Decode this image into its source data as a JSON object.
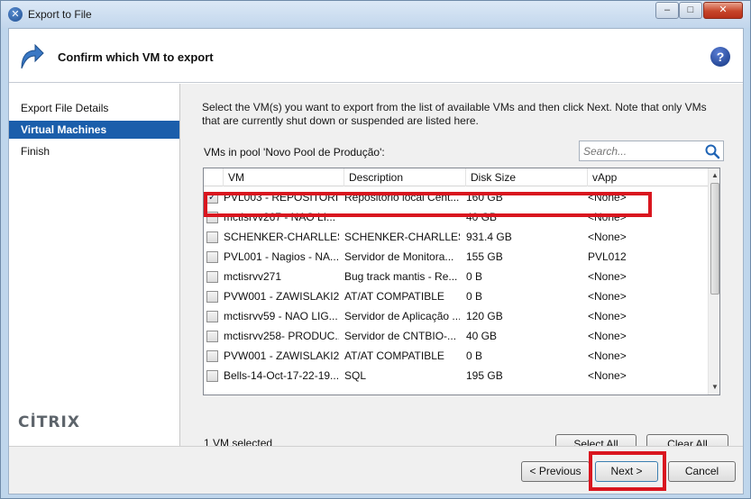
{
  "window": {
    "title": "Export to File",
    "min_label": "–",
    "max_label": "□",
    "close_label": "✕"
  },
  "header": {
    "title": "Confirm which VM to export",
    "help_label": "?"
  },
  "sidebar": {
    "items": [
      {
        "label": "Export File Details",
        "active": false
      },
      {
        "label": "Virtual Machines",
        "active": true
      },
      {
        "label": "Finish",
        "active": false
      }
    ],
    "logo_text": "CİTRIX"
  },
  "content": {
    "instructions": "Select the VM(s) you want to export from the list of available VMs and then click Next. Note that only VMs that are currently shut down or suspended are listed here.",
    "pool_label": "VMs in pool 'Novo Pool de Produção':",
    "search_placeholder": "Search...",
    "columns": [
      "VM",
      "Description",
      "Disk Size",
      "vApp"
    ],
    "rows": [
      {
        "checked": "✓",
        "vm": "PVL003 - REPOSITORI...",
        "description": "Repositorio local Cent...",
        "disk": "160 GB",
        "vapp": "<None>"
      },
      {
        "checked": "",
        "vm": "mctisrvv267 - NAO LI...",
        "description": "",
        "disk": "40 GB",
        "vapp": "<None>"
      },
      {
        "checked": "",
        "vm": "SCHENKER-CHARLLES",
        "description": "SCHENKER-CHARLLES...",
        "disk": "931.4 GB",
        "vapp": "<None>"
      },
      {
        "checked": "",
        "vm": "PVL001 - Nagios - NA...",
        "description": "Servidor de Monitora...",
        "disk": "155 GB",
        "vapp": "PVL012"
      },
      {
        "checked": "",
        "vm": "mctisrvv271",
        "description": "Bug track mantis - Re...",
        "disk": "0 B",
        "vapp": "<None>"
      },
      {
        "checked": "",
        "vm": "PVW001 - ZAWISLAKI2",
        "description": "AT/AT COMPATIBLE",
        "disk": "0 B",
        "vapp": "<None>"
      },
      {
        "checked": "",
        "vm": "mctisrvv59 - NAO LIG...",
        "description": "Servidor de Aplicação ...",
        "disk": "120 GB",
        "vapp": "<None>"
      },
      {
        "checked": "",
        "vm": "mctisrvv258- PRODUC...",
        "description": "Servidor de CNTBIO-...",
        "disk": "40 GB",
        "vapp": "<None>"
      },
      {
        "checked": "",
        "vm": "PVW001 - ZAWISLAKI2",
        "description": "AT/AT COMPATIBLE",
        "disk": "0 B",
        "vapp": "<None>"
      },
      {
        "checked": "",
        "vm": "Bells-14-Oct-17-22-19...",
        "description": "SQL",
        "disk": "195 GB",
        "vapp": "<None>"
      }
    ],
    "selected_count": "1 VM selected",
    "select_all_label": "Select All",
    "clear_all_label": "Clear All"
  },
  "footer": {
    "previous_label": "< Previous",
    "next_label": "Next >",
    "cancel_label": "Cancel"
  },
  "colors": {
    "accent": "#1b5eab",
    "highlight": "#d9161f"
  }
}
